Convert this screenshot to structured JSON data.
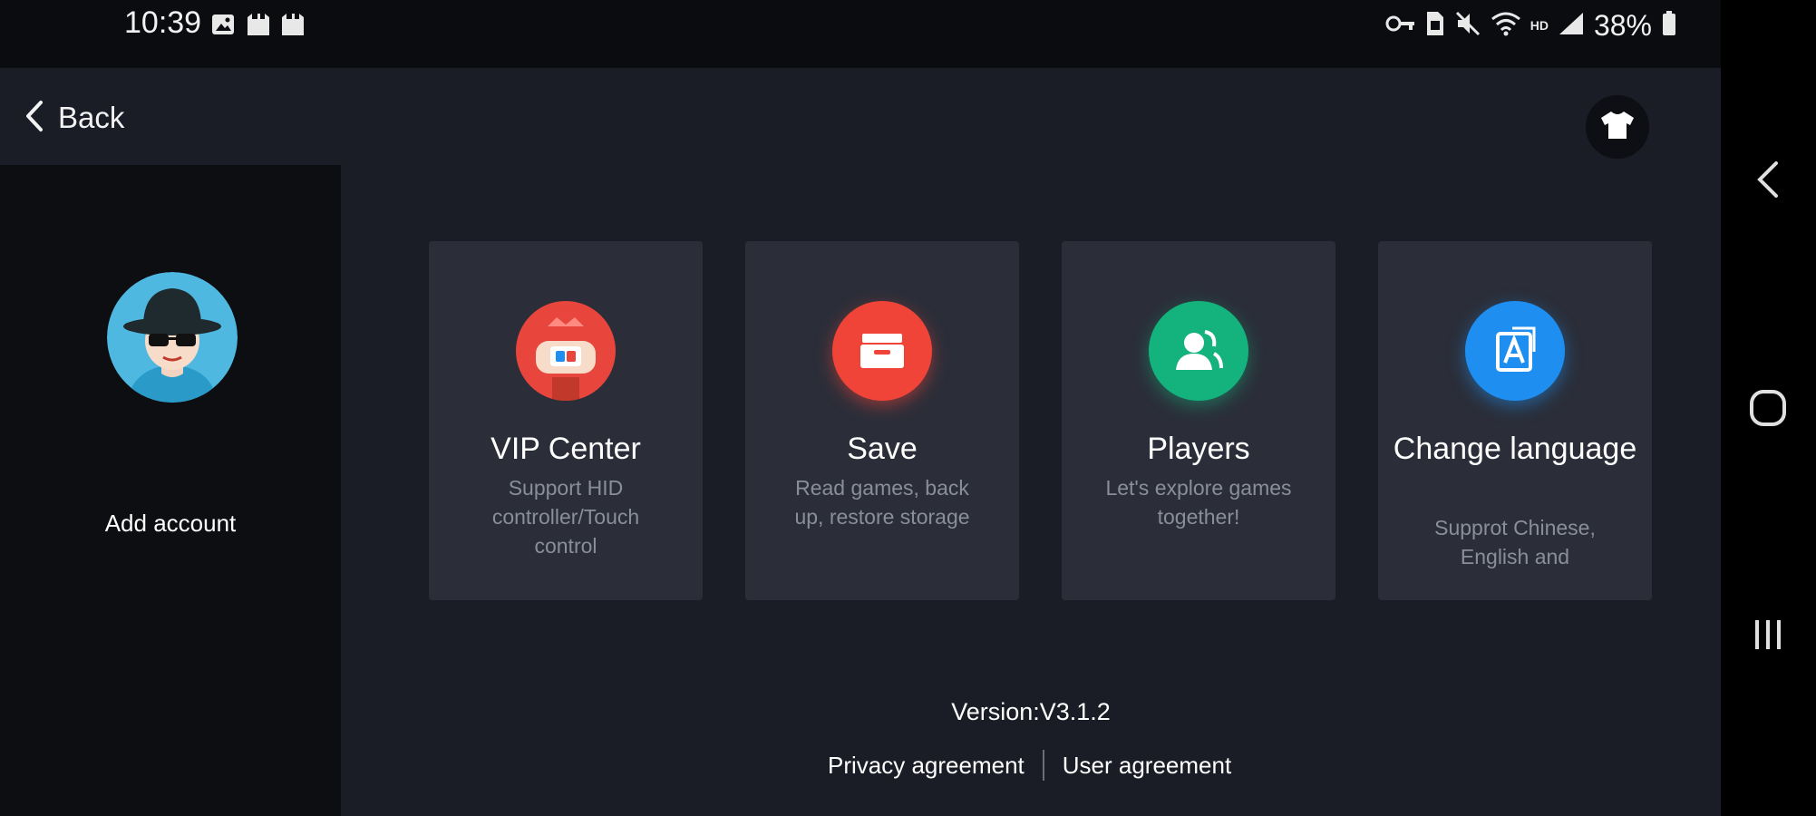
{
  "status_bar": {
    "time": "10:39",
    "battery": "38%",
    "left_icons": [
      "gallery-icon",
      "game-notification-icon",
      "game-notification-icon"
    ],
    "right_icons": [
      "key-icon",
      "sim-icon",
      "mute-icon",
      "wifi-icon",
      "hd-icon",
      "signal-icon",
      "battery-icon"
    ],
    "hd_label": "HD"
  },
  "header": {
    "back_label": "Back",
    "theme_icon": "tshirt-icon"
  },
  "sidebar": {
    "add_account_label": "Add account"
  },
  "cards": [
    {
      "title": "VIP Center",
      "description": "Support HID controller/Touch control",
      "icon": "vip-controller-icon",
      "color": "#e8453c"
    },
    {
      "title": "Save",
      "description": "Read games, back up, restore storage",
      "icon": "storage-box-icon",
      "color": "#f04438"
    },
    {
      "title": "Players",
      "description": "Let's explore games together!",
      "icon": "players-icon",
      "color": "#14b37d"
    },
    {
      "title": "Change language",
      "description": "Supprot Chinese, English and",
      "icon": "language-icon",
      "color": "#1e8ff0"
    }
  ],
  "footer": {
    "version": "Version:V3.1.2",
    "privacy_label": "Privacy agreement",
    "user_label": "User agreement"
  },
  "nav_bar": {
    "icons": [
      "back-nav-icon",
      "home-nav-icon",
      "recents-nav-icon"
    ]
  },
  "colors": {
    "app_background": "#1a1c26",
    "sidebar_background": "#0d0e12",
    "card_background": "#2b2e39",
    "description_text": "#8a8e99"
  }
}
